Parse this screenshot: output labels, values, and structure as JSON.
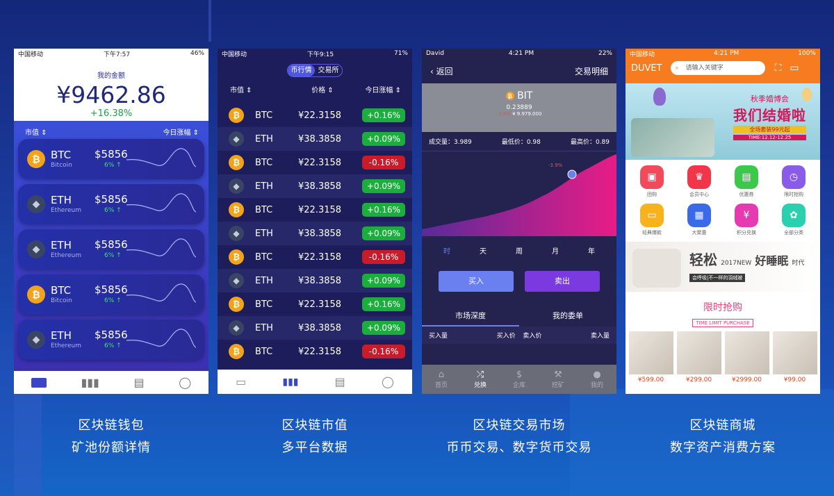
{
  "colors": {
    "btc": "#f3a21c",
    "eth": "#3a4566",
    "up": "#1cae3c",
    "down": "#c81c2a",
    "accent": "#4f56e6",
    "orange": "#f67c1f"
  },
  "captions": [
    {
      "line1": "区块链钱包",
      "line2": "矿池份额详情"
    },
    {
      "line1": "区块链市值",
      "line2": "多平台数据"
    },
    {
      "line1": "区块链交易市场",
      "line2": "币币交易、数字货币交易"
    },
    {
      "line1": "区块链商城",
      "line2": "数字资产消费方案"
    }
  ],
  "wallet": {
    "status": {
      "carrier": "中国移动",
      "time": "下午7:57",
      "battery": "46%"
    },
    "label": "我的金额",
    "amount": "¥9462.86",
    "change": "+16.38%",
    "col_left": "市值",
    "col_right": "今日涨幅",
    "cards": [
      {
        "symbol": "BTC",
        "name": "Bitcoin",
        "price": "$5856",
        "pct": "6%",
        "type": "btc"
      },
      {
        "symbol": "ETH",
        "name": "Ethereum",
        "price": "$5856",
        "pct": "6%",
        "type": "eth"
      },
      {
        "symbol": "ETH",
        "name": "Ethereum",
        "price": "$5856",
        "pct": "6%",
        "type": "eth"
      },
      {
        "symbol": "BTC",
        "name": "Bitcoin",
        "price": "$5856",
        "pct": "6%",
        "type": "btc"
      },
      {
        "symbol": "ETH",
        "name": "Ethereum",
        "price": "$5856",
        "pct": "6%",
        "type": "eth"
      }
    ]
  },
  "market": {
    "status": {
      "carrier": "中国移动",
      "time": "下午9:15",
      "battery": "71%"
    },
    "toggle": [
      "币行情",
      "交易所"
    ],
    "headers": [
      "市值",
      "价格",
      "今日涨幅"
    ],
    "rows": [
      {
        "symbol": "BTC",
        "price": "¥22.3158",
        "pct": "+0.16%",
        "dir": "up",
        "type": "btc"
      },
      {
        "symbol": "ETH",
        "price": "¥38.3858",
        "pct": "+0.09%",
        "dir": "up",
        "type": "eth"
      },
      {
        "symbol": "BTC",
        "price": "¥22.3158",
        "pct": "-0.16%",
        "dir": "dn",
        "type": "btc"
      },
      {
        "symbol": "ETH",
        "price": "¥38.3858",
        "pct": "+0.09%",
        "dir": "up",
        "type": "eth"
      },
      {
        "symbol": "BTC",
        "price": "¥22.3158",
        "pct": "+0.16%",
        "dir": "up",
        "type": "btc"
      },
      {
        "symbol": "ETH",
        "price": "¥38.3858",
        "pct": "+0.09%",
        "dir": "up",
        "type": "eth"
      },
      {
        "symbol": "BTC",
        "price": "¥22.3158",
        "pct": "-0.16%",
        "dir": "dn",
        "type": "btc"
      },
      {
        "symbol": "ETH",
        "price": "¥38.3858",
        "pct": "+0.09%",
        "dir": "up",
        "type": "eth"
      },
      {
        "symbol": "BTC",
        "price": "¥22.3158",
        "pct": "+0.16%",
        "dir": "up",
        "type": "btc"
      },
      {
        "symbol": "ETH",
        "price": "¥38.3858",
        "pct": "+0.09%",
        "dir": "up",
        "type": "eth"
      },
      {
        "symbol": "BTC",
        "price": "¥22.3158",
        "pct": "-0.16%",
        "dir": "dn",
        "type": "btc"
      }
    ]
  },
  "exchange": {
    "status": {
      "carrier": "David",
      "time": "4:21 PM",
      "battery": "22%"
    },
    "back": "返回",
    "title": "交易明细",
    "coin": "BIT",
    "price": "0.23889",
    "delta": "-3.9%",
    "volume_small": "¥ 9.979.000",
    "stats": [
      "成交量：3.989",
      "最低价：0.98",
      "最高价：0.89"
    ],
    "point_label": "-3.9%",
    "ranges": [
      "时",
      "天",
      "周",
      "月",
      "年"
    ],
    "buy": "买入",
    "sell": "卖出",
    "tabs": [
      "市场深度",
      "我的委单"
    ],
    "cols": [
      "买入量",
      "买入价",
      "卖入价",
      "卖入量"
    ],
    "nav": [
      "首页",
      "兑换",
      "企库",
      "挖矿",
      "我的"
    ]
  },
  "shop": {
    "status": {
      "carrier": "中国移动",
      "time": "4:21 PM",
      "battery": "100%"
    },
    "brand": "DUVET",
    "search_placeholder": "请输入关键字",
    "banner": {
      "line1": "秋季婚博会",
      "line2": "我们结婚啦",
      "line3": "全场套装99元起",
      "line4": "TIME:12.12-12.25"
    },
    "icons": [
      "团购",
      "会员中心",
      "优惠券",
      "限时抢购",
      "经典爆款",
      "大聚惠",
      "积分兑换",
      "全部分类"
    ],
    "promo": {
      "big": "轻松",
      "small1": "2017NEW",
      "mid": "好睡眠",
      "tag": "时代",
      "sub": "会呼吸|不一样的羽绒被"
    },
    "flash_title": "限时抢购",
    "flash_sub": "TIME LIMIT PURCHASE",
    "prices": [
      "¥599.00",
      "¥299.00",
      "¥2999.00",
      "¥99.00"
    ]
  }
}
